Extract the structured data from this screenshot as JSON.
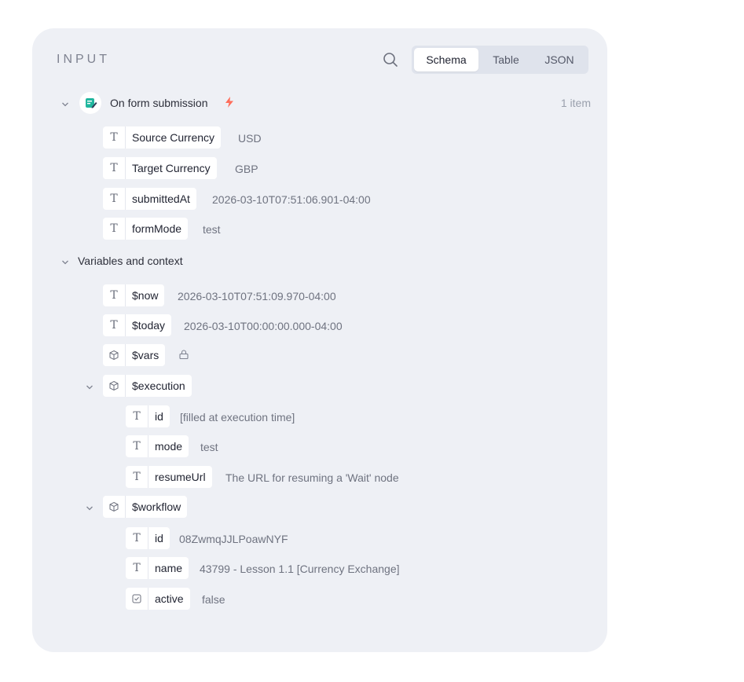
{
  "panel": {
    "title": "INPUT",
    "tabs": [
      {
        "label": "Schema",
        "active": true
      },
      {
        "label": "Table",
        "active": false
      },
      {
        "label": "JSON",
        "active": false
      }
    ]
  },
  "trigger": {
    "label": "On form submission",
    "count": "1 item",
    "fields": [
      {
        "type": "T",
        "key": "Source Currency",
        "value": "USD"
      },
      {
        "type": "T",
        "key": "Target Currency",
        "value": "GBP"
      },
      {
        "type": "T",
        "key": "submittedAt",
        "value": "2026-03-10T07:51:06.901-04:00"
      },
      {
        "type": "T",
        "key": "formMode",
        "value": "test"
      }
    ]
  },
  "variables": {
    "label": "Variables and context",
    "now": {
      "type": "T",
      "key": "$now",
      "value": "2026-03-10T07:51:09.970-04:00"
    },
    "today": {
      "type": "T",
      "key": "$today",
      "value": "2026-03-10T00:00:00.000-04:00"
    },
    "vars": {
      "type": "object",
      "key": "$vars"
    },
    "execution": {
      "key": "$execution",
      "fields": [
        {
          "type": "T",
          "key": "id",
          "value": "[filled at execution time]"
        },
        {
          "type": "T",
          "key": "mode",
          "value": "test"
        },
        {
          "type": "T",
          "key": "resumeUrl",
          "value": "The URL for resuming a 'Wait' node"
        }
      ]
    },
    "workflow": {
      "key": "$workflow",
      "fields": [
        {
          "type": "T",
          "key": "id",
          "value": "08ZwmqJJLPoawNYF"
        },
        {
          "type": "T",
          "key": "name",
          "value": "43799 - Lesson 1.1 [Currency Exchange]"
        },
        {
          "type": "bool",
          "key": "active",
          "value": "false"
        }
      ]
    }
  },
  "colors": {
    "panel_bg": "#eef0f5",
    "accent_trigger": "#ff6d5a",
    "form_icon": "#20b69e"
  },
  "icons": {
    "search": "search-icon",
    "chevron": "chevron-down-icon",
    "form": "form-trigger-icon",
    "bolt": "lightning-icon",
    "string": "string-type-icon",
    "object": "cube-icon",
    "boolean": "checkbox-icon",
    "lock": "lock-icon"
  }
}
